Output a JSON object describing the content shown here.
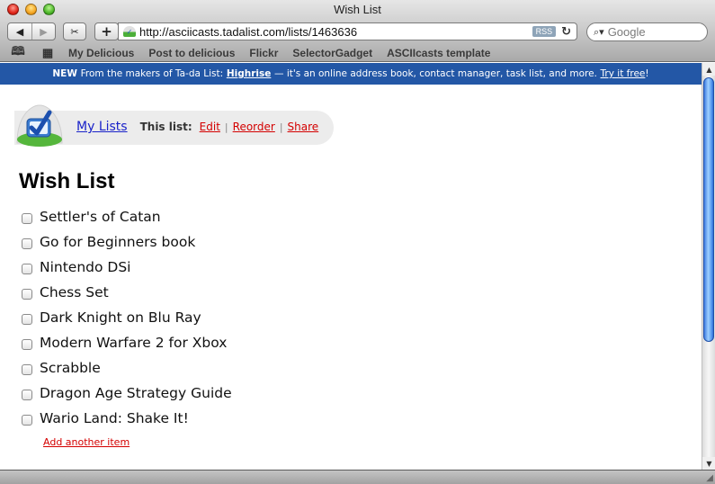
{
  "window": {
    "title": "Wish List"
  },
  "toolbar": {
    "back_icon": "◀",
    "forward_icon": "▶",
    "snip_icon": "✂",
    "add_icon": "+",
    "url": "http://asciicasts.tadalist.com/lists/1463636",
    "rss_label": "RSS",
    "reload_icon": "↻",
    "search_icon": "🔍▾",
    "search_placeholder": "Google"
  },
  "bookmarks": {
    "book_icon": "📖",
    "grid_icon": "▦",
    "items": [
      "My Delicious",
      "Post to delicious",
      "Flickr",
      "SelectorGadget",
      "ASCIIcasts template"
    ]
  },
  "promo": {
    "new_label": "NEW",
    "text_before": "From the makers of Ta-da List:",
    "link_highrise": "Highrise",
    "text_middle": "— it's an online address book, contact manager, task list, and more.",
    "link_try": "Try it free",
    "text_end": "!",
    "background_color": "#2357a6"
  },
  "nav": {
    "my_lists": "My Lists",
    "this_list_label": "This list:",
    "edit": "Edit",
    "reorder": "Reorder",
    "share": "Share",
    "separator": "|"
  },
  "list": {
    "title": "Wish List",
    "items": [
      {
        "label": "Settler's of Catan",
        "checked": false
      },
      {
        "label": "Go for Beginners book",
        "checked": false
      },
      {
        "label": "Nintendo DSi",
        "checked": false
      },
      {
        "label": "Chess Set",
        "checked": false
      },
      {
        "label": "Dark Knight on Blu Ray",
        "checked": false
      },
      {
        "label": "Modern Warfare 2 for Xbox",
        "checked": false
      },
      {
        "label": "Scrabble",
        "checked": false
      },
      {
        "label": "Dragon Age Strategy Guide",
        "checked": false
      },
      {
        "label": "Wario Land: Shake It!",
        "checked": false
      }
    ],
    "add_item_link": "Add another item"
  },
  "scrollbar": {
    "up_icon": "▲",
    "down_icon": "▼",
    "position_fraction": 0.0,
    "visible_fraction": 0.7
  },
  "colors": {
    "link_red": "#d40000",
    "link_blue": "#1a22c9"
  }
}
